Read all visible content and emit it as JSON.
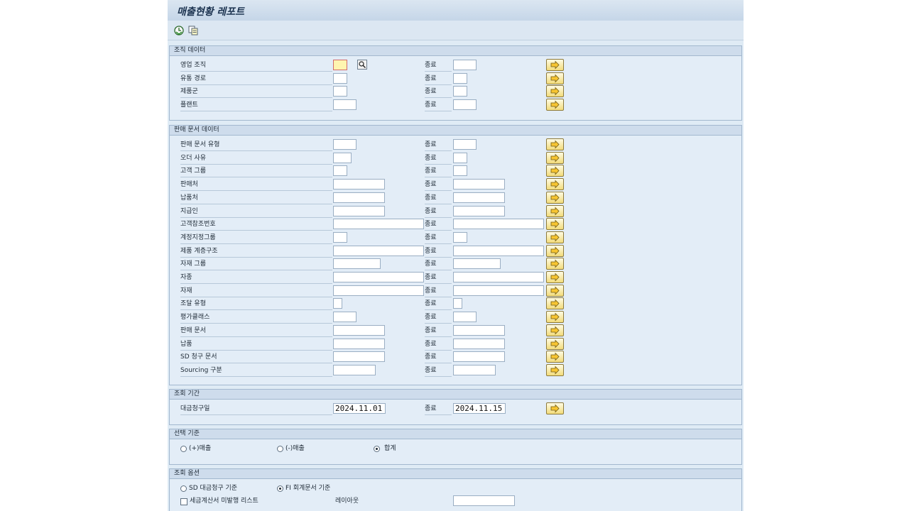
{
  "title": "매출현황 레포트",
  "toolbar": {
    "icons": [
      "execute-icon",
      "variant-icon"
    ]
  },
  "to_label": "종료",
  "groups": {
    "org": {
      "header": "조직 데이터",
      "rows": [
        "영업 조직",
        "유통 경로",
        "제품군",
        "플랜트"
      ]
    },
    "sales": {
      "header": "판매 문서 데이터",
      "rows": [
        "판매 문서 유형",
        "오더 사유",
        "고객 그룹",
        "판매처",
        "납품처",
        "지급인",
        "고객참조번호",
        "계정지정그룹",
        "제품 계층구조",
        "자재 그룹",
        "자종",
        "자재",
        "조달 유형",
        "평가클래스",
        "판매 문서",
        "납품",
        "SD 청구 문서",
        "Sourcing 구분"
      ]
    },
    "period": {
      "header": "조회 기간",
      "row_label": "대금청구일",
      "from": "2024.11.01",
      "to": "2024.11.15"
    },
    "criteria": {
      "header": "선택 기준",
      "options": [
        "(+)매출",
        "(-)매출",
        "합계"
      ],
      "selected": 2
    },
    "options": {
      "header": "조회 옵션",
      "radios": [
        "SD 대금청구 기준",
        "FI 회계문서 기준"
      ],
      "selected": 1,
      "checkbox_label": "세금계산서 미발행 리스트",
      "layout_label": "레이아웃"
    }
  }
}
